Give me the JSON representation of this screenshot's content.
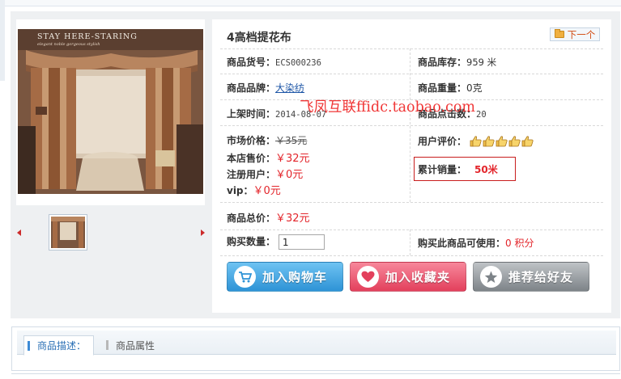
{
  "gallery": {
    "caption": "STAY HERE-STARING",
    "subcaption": "elegant    noble    gorgeous    stylish"
  },
  "product": {
    "title": "4高档提花布",
    "next_label": "下一个",
    "sku_label": "商品货号：",
    "sku_value": "ECS000236",
    "stock_label": "商品库存：",
    "stock_value": "959 米",
    "brand_label": "商品品牌：",
    "brand_value": "大染纺",
    "weight_label": "商品重量：",
    "weight_value": "0克",
    "date_label": "上架时间：",
    "date_value": "2014-08-07",
    "clicks_label": "商品点击数：",
    "clicks_value": "20",
    "market_label": "市场价格：",
    "market_value": "￥35元",
    "store_label": "本店售价：",
    "store_value": "￥32元",
    "member_label": "注册用户：",
    "member_value": "￥0元",
    "vip_label": "vip：",
    "vip_value": "￥0元",
    "rating_label": "用户评价：",
    "rating_value": 5,
    "sales_label": "累计销量：",
    "sales_value": "50米",
    "total_label": "商品总价：",
    "total_value": "￥32元",
    "qty_label": "购买数量：",
    "qty_value": "1",
    "points_label": "购买此商品可使用：",
    "points_value": "0 积分"
  },
  "watermark": "飞凤互联ffidc.taobao.com",
  "actions": {
    "cart": "加入购物车",
    "fav": "加入收藏夹",
    "share": "推荐给好友"
  },
  "tabs": [
    {
      "label": "商品描述："
    },
    {
      "label": "商品属性"
    }
  ],
  "colors": {
    "price_red": "#e3252b",
    "link_blue": "#1c55a6",
    "highlight_border": "#c81d1d"
  }
}
